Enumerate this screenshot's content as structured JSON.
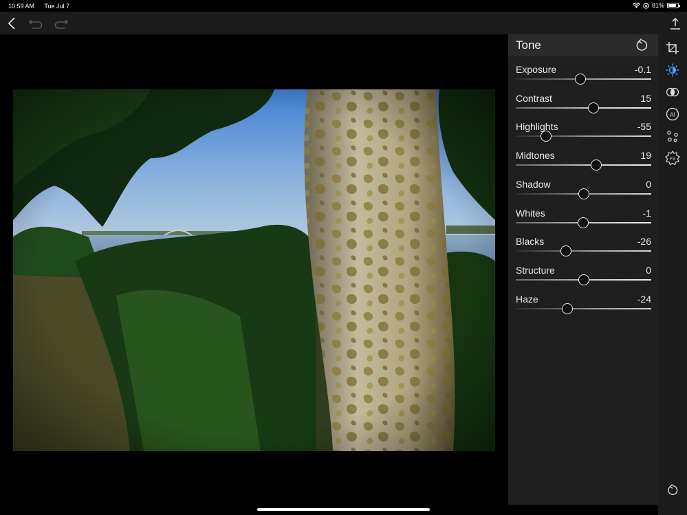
{
  "status": {
    "time": "10:59 AM",
    "date": "Tue Jul 7",
    "battery": "81%",
    "battery_level": 0.81
  },
  "panel": {
    "title": "Tone",
    "sliders": [
      {
        "label": "Exposure",
        "value": "-0.1",
        "min": -2,
        "max": 2,
        "num": -0.1
      },
      {
        "label": "Contrast",
        "value": "15",
        "min": -100,
        "max": 100,
        "num": 15
      },
      {
        "label": "Highlights",
        "value": "-55",
        "min": -100,
        "max": 100,
        "num": -55
      },
      {
        "label": "Midtones",
        "value": "19",
        "min": -100,
        "max": 100,
        "num": 19
      },
      {
        "label": "Shadow",
        "value": "0",
        "min": -100,
        "max": 100,
        "num": 0
      },
      {
        "label": "Whites",
        "value": "-1",
        "min": -100,
        "max": 100,
        "num": -1
      },
      {
        "label": "Blacks",
        "value": "-26",
        "min": -100,
        "max": 100,
        "num": -26
      },
      {
        "label": "Structure",
        "value": "0",
        "min": -100,
        "max": 100,
        "num": 0
      },
      {
        "label": "Haze",
        "value": "-24",
        "min": -100,
        "max": 100,
        "num": -24
      }
    ]
  },
  "tools": {
    "active": "tone-icon",
    "list": [
      "crop-icon",
      "tone-icon",
      "color-icon",
      "ai-icon",
      "layers-icon",
      "fx-icon"
    ],
    "ai_label": "AI",
    "fx_label": "FX"
  },
  "colors": {
    "accent": "#4aa3ff",
    "panel_bg": "#1f1f1f",
    "header_bg": "#2b2b2b"
  }
}
